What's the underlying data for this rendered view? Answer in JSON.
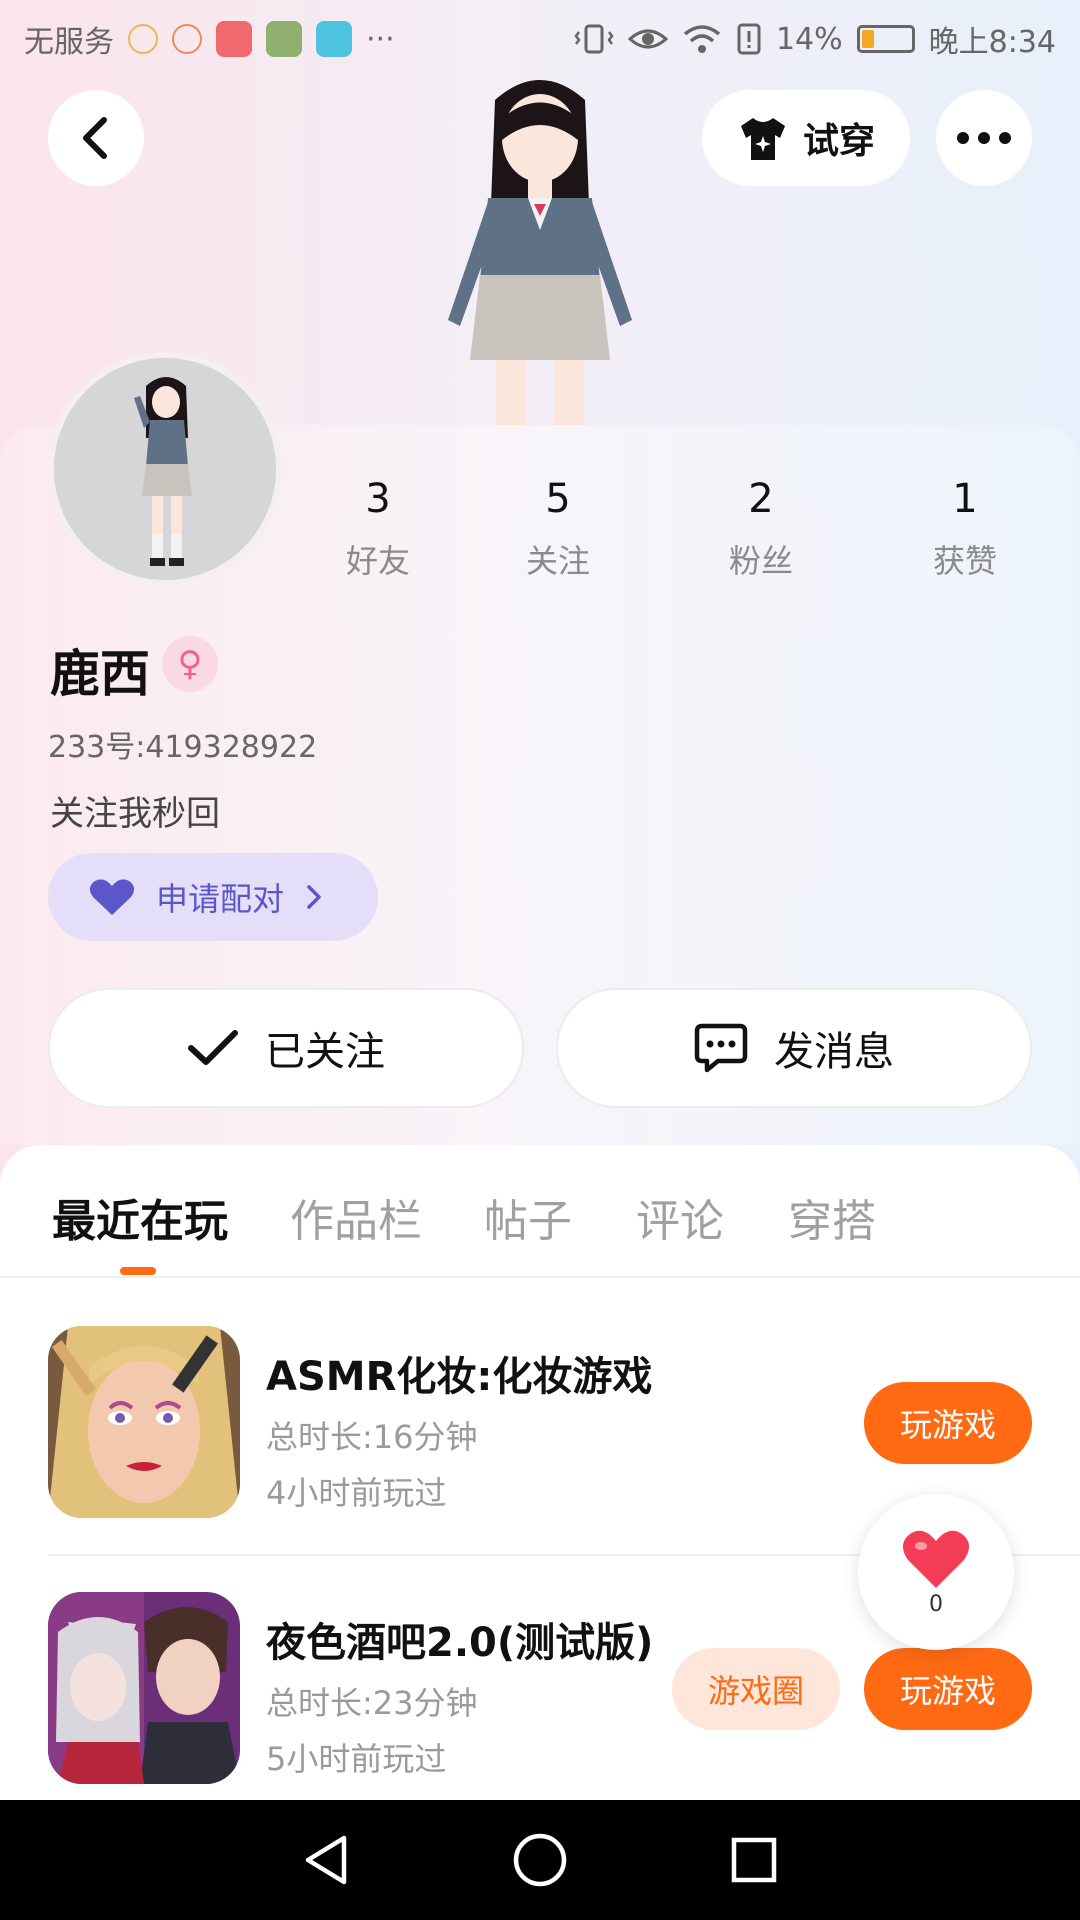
{
  "status_bar": {
    "carrier": "无服务",
    "battery": "14%",
    "time": "晚上8:34",
    "more": "···"
  },
  "header": {
    "try_on_label": "试穿"
  },
  "profile": {
    "stats": [
      {
        "value": "3",
        "label": "好友"
      },
      {
        "value": "5",
        "label": "关注"
      },
      {
        "value": "2",
        "label": "粉丝"
      },
      {
        "value": "1",
        "label": "获赞"
      }
    ],
    "name": "鹿西",
    "gender_symbol": "♀",
    "uid": "233号:419328922",
    "bio": "关注我秒回",
    "pair_label": "申请配对"
  },
  "actions": {
    "followed_label": "已关注",
    "message_label": "发消息"
  },
  "tabs": [
    {
      "label": "最近在玩",
      "active": true
    },
    {
      "label": "作品栏",
      "active": false
    },
    {
      "label": "帖子",
      "active": false
    },
    {
      "label": "评论",
      "active": false
    },
    {
      "label": "穿搭",
      "active": false
    }
  ],
  "games": [
    {
      "title": "ASMR化妆:化妆游戏",
      "duration": "总时长:16分钟",
      "last_played": "4小时前玩过",
      "play_label": "玩游戏"
    },
    {
      "title": "夜色酒吧2.0(测试版)",
      "duration": "总时长:23分钟",
      "last_played": "5小时前玩过",
      "play_label": "玩游戏",
      "circle_label": "游戏圈"
    }
  ],
  "like_fab": {
    "count": "0"
  },
  "colors": {
    "accent": "#ff6a13",
    "pair_bg": "#e4def8",
    "pair_text": "#5b56c9",
    "heart": "#f33d57"
  }
}
